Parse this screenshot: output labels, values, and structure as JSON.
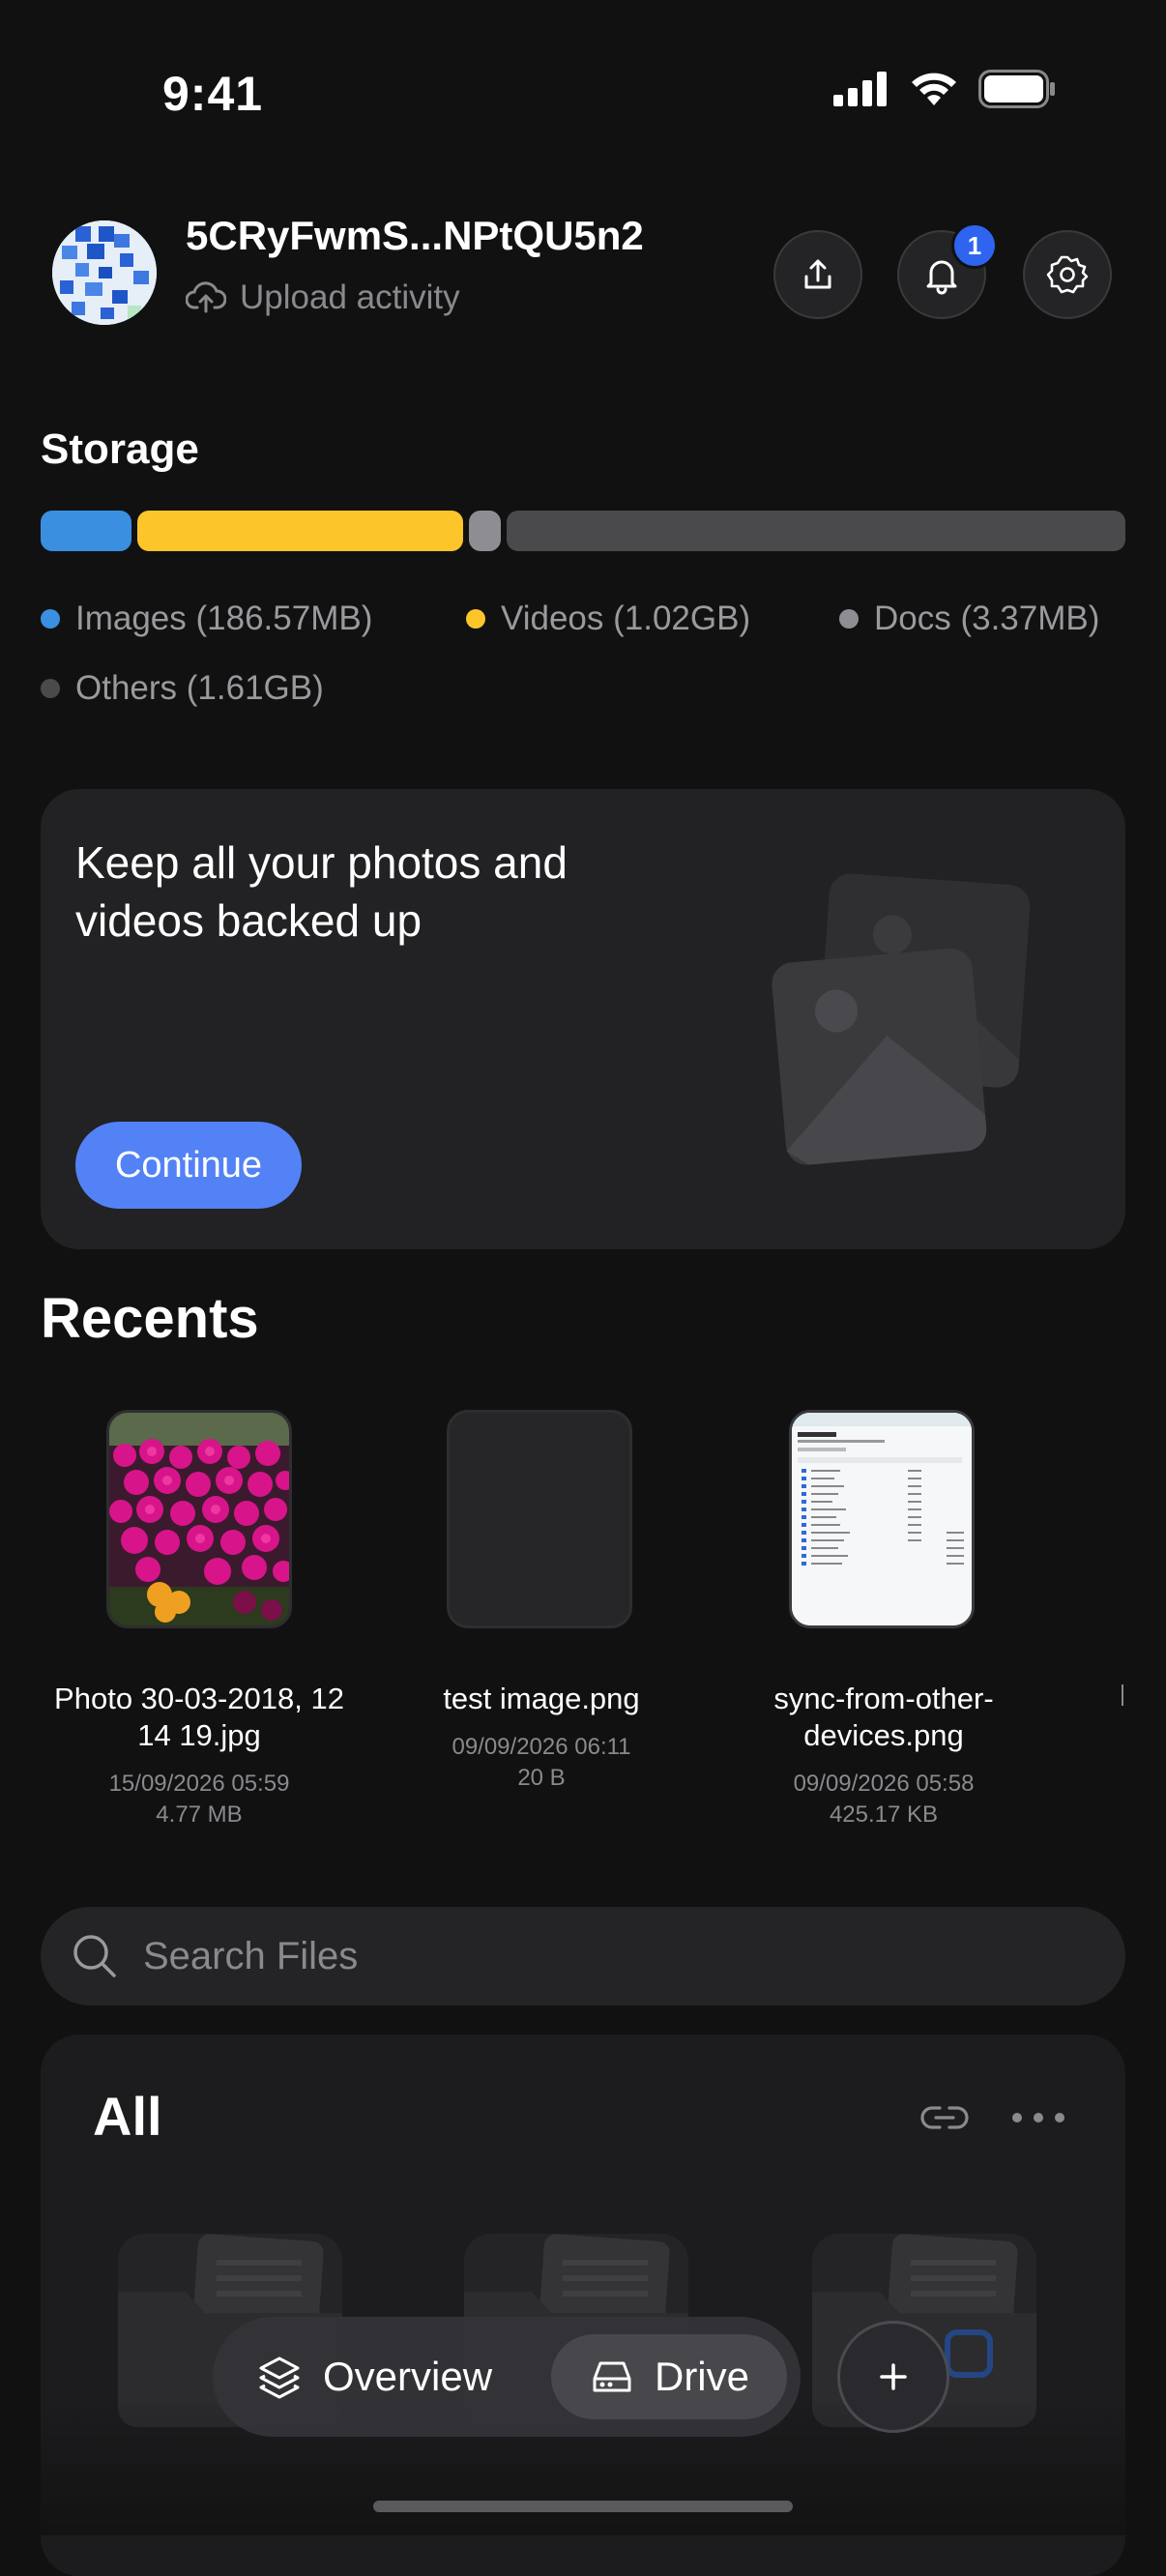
{
  "status_bar": {
    "time": "9:41"
  },
  "header": {
    "account_name": "5CRyFwmS...NPtQU5n2",
    "upload_activity_label": "Upload activity",
    "notification_count": "1"
  },
  "storage": {
    "title": "Storage",
    "categories": [
      {
        "label": "Images (186.57MB)",
        "color": "#3b8fe0",
        "fraction": 0.085
      },
      {
        "label": "Videos (1.02GB)",
        "color": "#fcc62a",
        "fraction": 0.305
      },
      {
        "label": "Docs (3.37MB)",
        "color": "#8e8e92",
        "fraction": 0.03
      },
      {
        "label": "Others (1.61GB)",
        "color": "#4a4a4c",
        "fraction": 0.58
      }
    ]
  },
  "backup_card": {
    "title": "Keep all your photos and videos backed up",
    "button_label": "Continue"
  },
  "recents": {
    "title": "Recents",
    "items": [
      {
        "name": "Photo 30-03-2018, 12 14 19.jpg",
        "date": "15/09/2026 05:59",
        "size": "4.77 MB"
      },
      {
        "name": "test image.png",
        "date": "09/09/2026 06:11",
        "size": "20 B"
      },
      {
        "name": "sync-from-other-devices.png",
        "date": "09/09/2026 05:58",
        "size": "425.17 KB"
      }
    ]
  },
  "search": {
    "placeholder": "Search Files"
  },
  "all_section": {
    "title": "All"
  },
  "bottom_nav": {
    "overview_label": "Overview",
    "drive_label": "Drive"
  },
  "icons": [
    "upload-icon",
    "bell-icon",
    "gear-icon",
    "cloud-upload-icon",
    "search-icon",
    "link-icon",
    "more-icon",
    "layers-icon",
    "drive-icon",
    "plus-icon",
    "image-icon"
  ]
}
